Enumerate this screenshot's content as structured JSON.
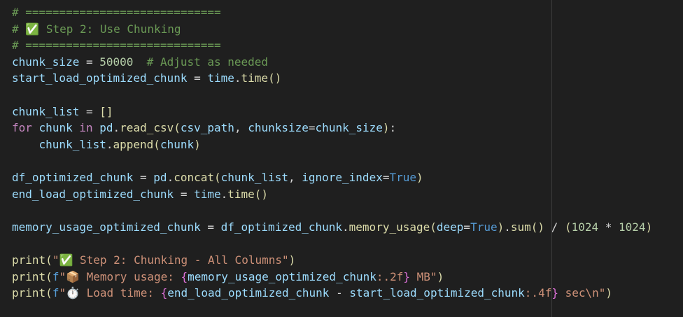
{
  "editor": {
    "colors": {
      "background": "#1f1f1f",
      "comment": "#6a9955",
      "keyword": "#569cd6",
      "control": "#c586c0",
      "function": "#dcdcaa",
      "variable": "#9cdcfe",
      "number": "#b5cea8",
      "string": "#ce9178",
      "default": "#d4d4d4",
      "brace": "#da70d6"
    },
    "lines": [
      [
        {
          "t": "# =============================",
          "c": "comment"
        }
      ],
      [
        {
          "t": "# ✅ Step 2: Use Chunking",
          "c": "comment"
        }
      ],
      [
        {
          "t": "# =============================",
          "c": "comment"
        }
      ],
      [
        {
          "t": "chunk_size",
          "c": "var"
        },
        {
          "t": " = ",
          "c": "default"
        },
        {
          "t": "50000",
          "c": "number"
        },
        {
          "t": "  ",
          "c": "default"
        },
        {
          "t": "# Adjust as needed",
          "c": "comment"
        }
      ],
      [
        {
          "t": "start_load_optimized_chunk",
          "c": "var"
        },
        {
          "t": " = ",
          "c": "default"
        },
        {
          "t": "time",
          "c": "var"
        },
        {
          "t": ".",
          "c": "default"
        },
        {
          "t": "time",
          "c": "func"
        },
        {
          "t": "()",
          "c": "func"
        }
      ],
      [],
      [
        {
          "t": "chunk_list",
          "c": "var"
        },
        {
          "t": " = ",
          "c": "default"
        },
        {
          "t": "[]",
          "c": "func"
        }
      ],
      [
        {
          "t": "for",
          "c": "control"
        },
        {
          "t": " ",
          "c": "default"
        },
        {
          "t": "chunk",
          "c": "var"
        },
        {
          "t": " ",
          "c": "default"
        },
        {
          "t": "in",
          "c": "control"
        },
        {
          "t": " ",
          "c": "default"
        },
        {
          "t": "pd",
          "c": "var"
        },
        {
          "t": ".",
          "c": "default"
        },
        {
          "t": "read_csv",
          "c": "func"
        },
        {
          "t": "(",
          "c": "func"
        },
        {
          "t": "csv_path",
          "c": "var"
        },
        {
          "t": ", ",
          "c": "default"
        },
        {
          "t": "chunksize",
          "c": "var"
        },
        {
          "t": "=",
          "c": "default"
        },
        {
          "t": "chunk_size",
          "c": "var"
        },
        {
          "t": ")",
          "c": "func"
        },
        {
          "t": ":",
          "c": "default"
        }
      ],
      [
        {
          "t": "    ",
          "c": "default"
        },
        {
          "t": "chunk_list",
          "c": "var"
        },
        {
          "t": ".",
          "c": "default"
        },
        {
          "t": "append",
          "c": "func"
        },
        {
          "t": "(",
          "c": "func"
        },
        {
          "t": "chunk",
          "c": "var"
        },
        {
          "t": ")",
          "c": "func"
        }
      ],
      [],
      [
        {
          "t": "df_optimized_chunk",
          "c": "var"
        },
        {
          "t": " = ",
          "c": "default"
        },
        {
          "t": "pd",
          "c": "var"
        },
        {
          "t": ".",
          "c": "default"
        },
        {
          "t": "concat",
          "c": "func"
        },
        {
          "t": "(",
          "c": "func"
        },
        {
          "t": "chunk_list",
          "c": "var"
        },
        {
          "t": ", ",
          "c": "default"
        },
        {
          "t": "ignore_index",
          "c": "var"
        },
        {
          "t": "=",
          "c": "default"
        },
        {
          "t": "True",
          "c": "keyword"
        },
        {
          "t": ")",
          "c": "func"
        }
      ],
      [
        {
          "t": "end_load_optimized_chunk",
          "c": "var"
        },
        {
          "t": " = ",
          "c": "default"
        },
        {
          "t": "time",
          "c": "var"
        },
        {
          "t": ".",
          "c": "default"
        },
        {
          "t": "time",
          "c": "func"
        },
        {
          "t": "()",
          "c": "func"
        }
      ],
      [],
      [
        {
          "t": "memory_usage_optimized_chunk",
          "c": "var"
        },
        {
          "t": " = ",
          "c": "default"
        },
        {
          "t": "df_optimized_chunk",
          "c": "var"
        },
        {
          "t": ".",
          "c": "default"
        },
        {
          "t": "memory_usage",
          "c": "func"
        },
        {
          "t": "(",
          "c": "func"
        },
        {
          "t": "deep",
          "c": "var"
        },
        {
          "t": "=",
          "c": "default"
        },
        {
          "t": "True",
          "c": "keyword"
        },
        {
          "t": ")",
          "c": "func"
        },
        {
          "t": ".",
          "c": "default"
        },
        {
          "t": "sum",
          "c": "func"
        },
        {
          "t": "()",
          "c": "func"
        },
        {
          "t": " / ",
          "c": "default"
        },
        {
          "t": "(",
          "c": "func"
        },
        {
          "t": "1024",
          "c": "number"
        },
        {
          "t": " * ",
          "c": "default"
        },
        {
          "t": "1024",
          "c": "number"
        },
        {
          "t": ")",
          "c": "func"
        }
      ],
      [],
      [
        {
          "t": "print",
          "c": "func"
        },
        {
          "t": "(",
          "c": "func"
        },
        {
          "t": "\"✅ Step 2: Chunking - All Columns\"",
          "c": "string"
        },
        {
          "t": ")",
          "c": "func"
        }
      ],
      [
        {
          "t": "print",
          "c": "func"
        },
        {
          "t": "(",
          "c": "func"
        },
        {
          "t": "f",
          "c": "keyword"
        },
        {
          "t": "\"📦 Memory usage: ",
          "c": "string"
        },
        {
          "t": "{",
          "c": "brace"
        },
        {
          "t": "memory_usage_optimized_chunk",
          "c": "var"
        },
        {
          "t": ":.2f",
          "c": "string"
        },
        {
          "t": "}",
          "c": "brace"
        },
        {
          "t": " MB\"",
          "c": "string"
        },
        {
          "t": ")",
          "c": "func"
        }
      ],
      [
        {
          "t": "print",
          "c": "func"
        },
        {
          "t": "(",
          "c": "func"
        },
        {
          "t": "f",
          "c": "keyword"
        },
        {
          "t": "\"⏱️ Load time: ",
          "c": "string"
        },
        {
          "t": "{",
          "c": "brace"
        },
        {
          "t": "end_load_optimized_chunk",
          "c": "var"
        },
        {
          "t": " - ",
          "c": "default"
        },
        {
          "t": "start_load_optimized_chunk",
          "c": "var"
        },
        {
          "t": ":.4f",
          "c": "string"
        },
        {
          "t": "}",
          "c": "brace"
        },
        {
          "t": " sec\\n\"",
          "c": "string"
        },
        {
          "t": ")",
          "c": "func"
        }
      ]
    ]
  }
}
